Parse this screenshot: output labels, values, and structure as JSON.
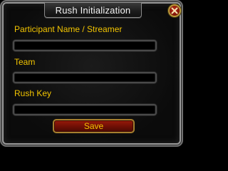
{
  "dialog": {
    "title": "Rush Initialization",
    "close_icon": "close-x-icon"
  },
  "fields": [
    {
      "label": "Participant Name / Streamer",
      "value": "",
      "placeholder": ""
    },
    {
      "label": "Team",
      "value": "",
      "placeholder": ""
    },
    {
      "label": "Rush Key",
      "value": "",
      "placeholder": ""
    }
  ],
  "actions": {
    "save_label": "Save"
  },
  "colors": {
    "label_gold": "#f2c400",
    "title_text": "#f2f2f2",
    "button_red": "#8a1508",
    "button_border_gold": "#a67f2e"
  }
}
